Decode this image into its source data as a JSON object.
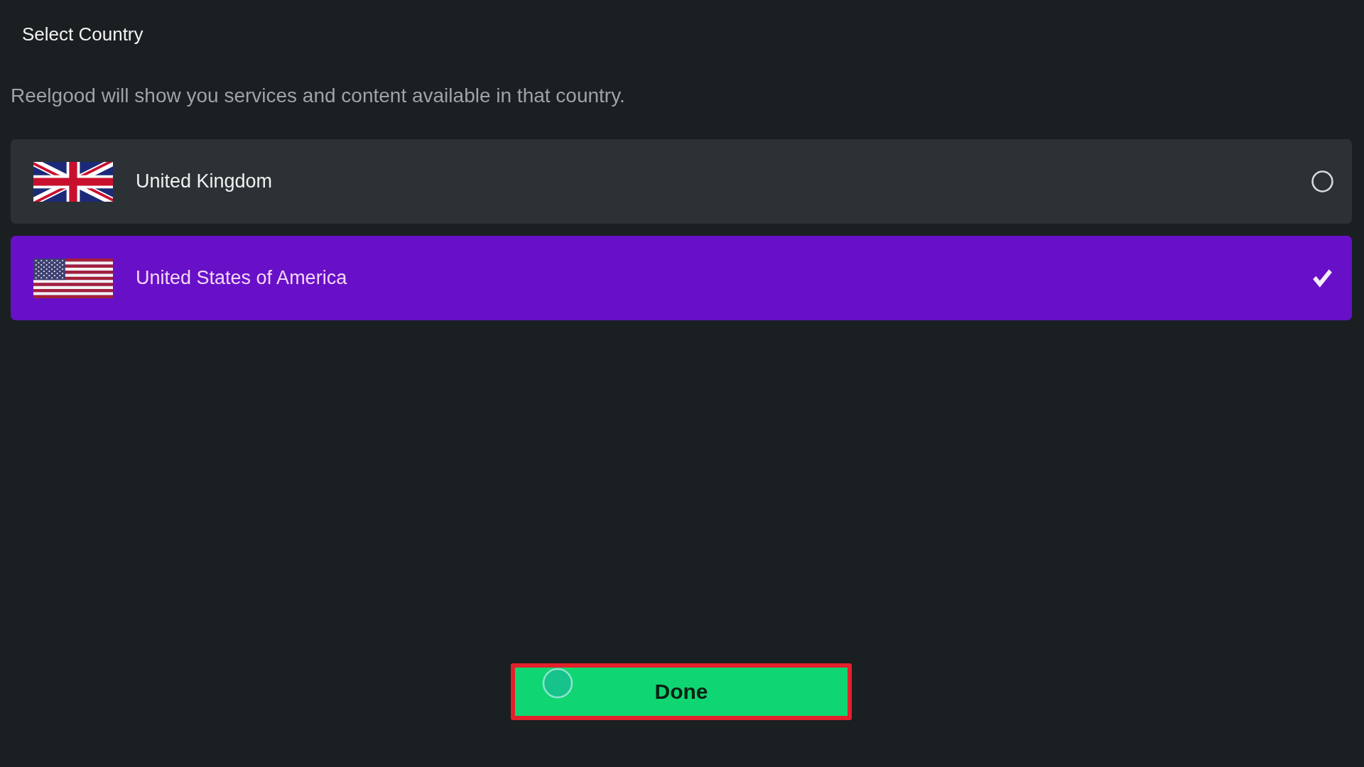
{
  "title": "Select Country",
  "description": "Reelgood will show you services and content available in that country.",
  "countries": [
    {
      "name": "United Kingdom",
      "kind": "uk",
      "selected": false
    },
    {
      "name": "United States of America",
      "kind": "us",
      "selected": true
    }
  ],
  "done_button": {
    "label": "Done",
    "highlighted": true
  }
}
